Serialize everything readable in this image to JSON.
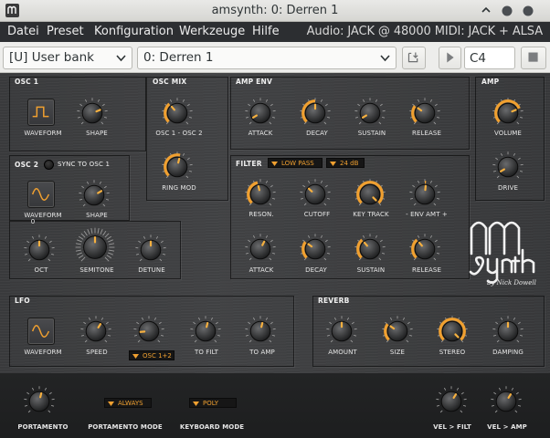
{
  "window": {
    "title": "amsynth: 0: Derren 1",
    "icon": "amsynth-app-icon",
    "controls": [
      "minimize-icon",
      "maximize-icon",
      "close-icon"
    ]
  },
  "menubar": {
    "items": [
      "Datei",
      "Preset",
      "Konfiguration",
      "Werkzeuge",
      "Hilfe"
    ],
    "status": "Audio: JACK @ 48000  MIDI: JACK + ALSA"
  },
  "toolbar": {
    "bank": "[U] User bank",
    "preset": "0: Derren 1",
    "save_icon": "save-to-bank-icon",
    "play_icon": "play-icon",
    "note": "C4",
    "stop_icon": "stop-icon"
  },
  "sections": {
    "osc1": "OSC 1",
    "osc2": "OSC 2",
    "sync": "SYNC TO OSC 1",
    "oscmix": "OSC MIX",
    "ampenv": "AMP ENV",
    "amp": "AMP",
    "filter": "FILTER",
    "lfo": "LFO",
    "reverb": "REVERB"
  },
  "labels": {
    "waveform": "WAVEFORM",
    "shape": "SHAPE",
    "osc_mix": "OSC 1 - OSC 2",
    "ring_mod": "RING MOD",
    "attack": "ATTACK",
    "decay": "DECAY",
    "sustain": "SUSTAIN",
    "release": "RELEASE",
    "volume": "VOLUME",
    "drive": "DRIVE",
    "reson": "RESON.",
    "cutoff": "CUTOFF",
    "key_track": "KEY TRACK",
    "env_amt": "- ENV AMT +",
    "oct": "OCT",
    "semitone": "SEMITONE",
    "detune": "DETUNE",
    "oct_zero": "0",
    "speed": "SPEED",
    "to_filt": "TO FILT",
    "to_amp": "TO AMP",
    "amount": "AMOUNT",
    "size": "SIZE",
    "stereo": "STEREO",
    "damping": "DAMPING",
    "portamento": "PORTAMENTO",
    "portamento_mode": "PORTAMENTO MODE",
    "keyboard_mode": "KEYBOARD MODE",
    "vel_filt": "VEL > FILT",
    "vel_amp": "VEL > AMP"
  },
  "selectors": {
    "filter_type": "LOW PASS",
    "filter_slope": "24 dB",
    "lfo_dest": "OSC 1+2",
    "portamento_mode": "ALWAYS",
    "keyboard_mode": "POLY"
  },
  "waveforms": {
    "osc1": "square-wave-icon",
    "osc2": "sine-wave-icon",
    "lfo": "sine-wave-icon"
  },
  "knob_values": {
    "osc1_shape": 0.75,
    "osc_mix": 0.35,
    "ring_mod": 0.55,
    "amp_attack": 0.05,
    "amp_decay": 0.5,
    "amp_sustain": 0.05,
    "amp_release": 0.3,
    "volume": 0.75,
    "drive": 0.05,
    "osc2_shape": 0.72,
    "filter_reson": 0.45,
    "filter_cutoff": 0.32,
    "key_track": 1.0,
    "env_amt": 0.52,
    "oct": 0.5,
    "semitone": 0.5,
    "detune": 0.5,
    "filter_attack": 0.6,
    "filter_decay": 0.3,
    "filter_sustain": 0.35,
    "filter_release": 0.35,
    "lfo_speed": 0.62,
    "lfo_osc": 0.15,
    "lfo_to_filt": 0.55,
    "lfo_to_amp": 0.55,
    "rev_amount": 0.5,
    "rev_size": 0.3,
    "rev_stereo": 1.0,
    "rev_damping": 0.5,
    "portamento": 0.55,
    "vel_filt": 0.62,
    "vel_amp": 0.62
  },
  "logo": {
    "byline": "by Nick Dowell"
  }
}
